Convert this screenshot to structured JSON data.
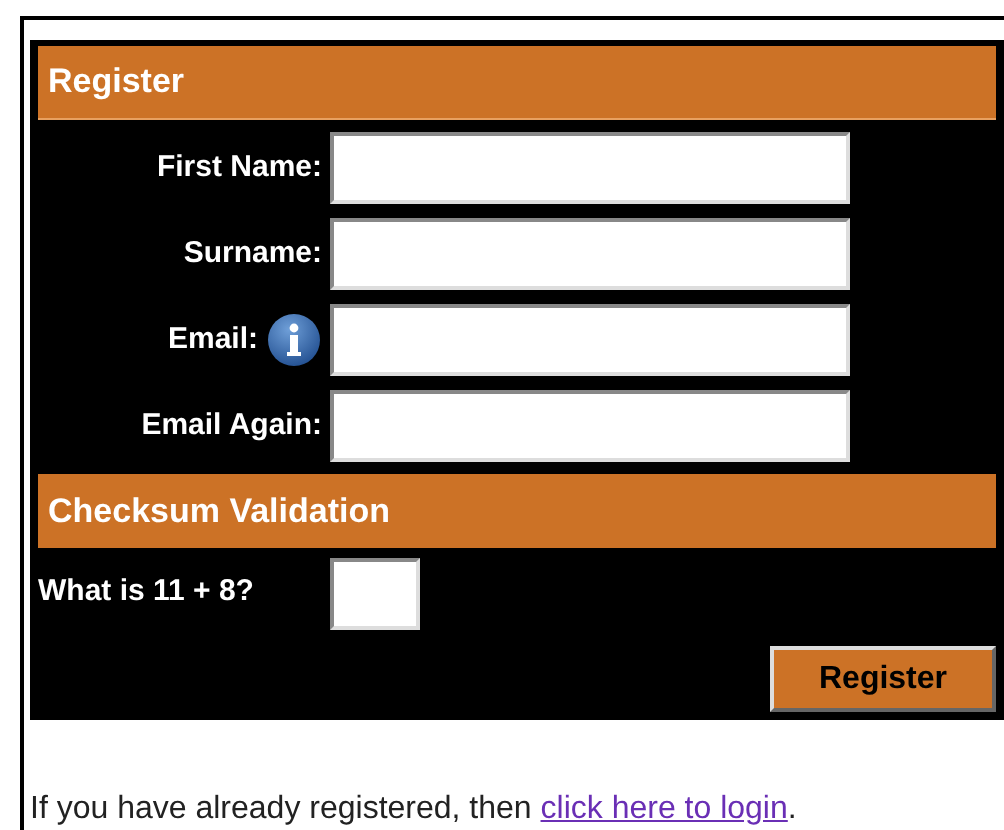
{
  "register_header": "Register",
  "fields": [
    {
      "label": "First Name:",
      "info": false
    },
    {
      "label": "Surname:",
      "info": false
    },
    {
      "label": "Email:",
      "info": true
    },
    {
      "label": "Email Again:",
      "info": false
    }
  ],
  "checksum_header": "Checksum Validation",
  "question": "What is 11 + 8?",
  "submit_button": "Register",
  "footer": {
    "text": "If you have already registered, then ",
    "link": "click here to login",
    "end": "."
  }
}
